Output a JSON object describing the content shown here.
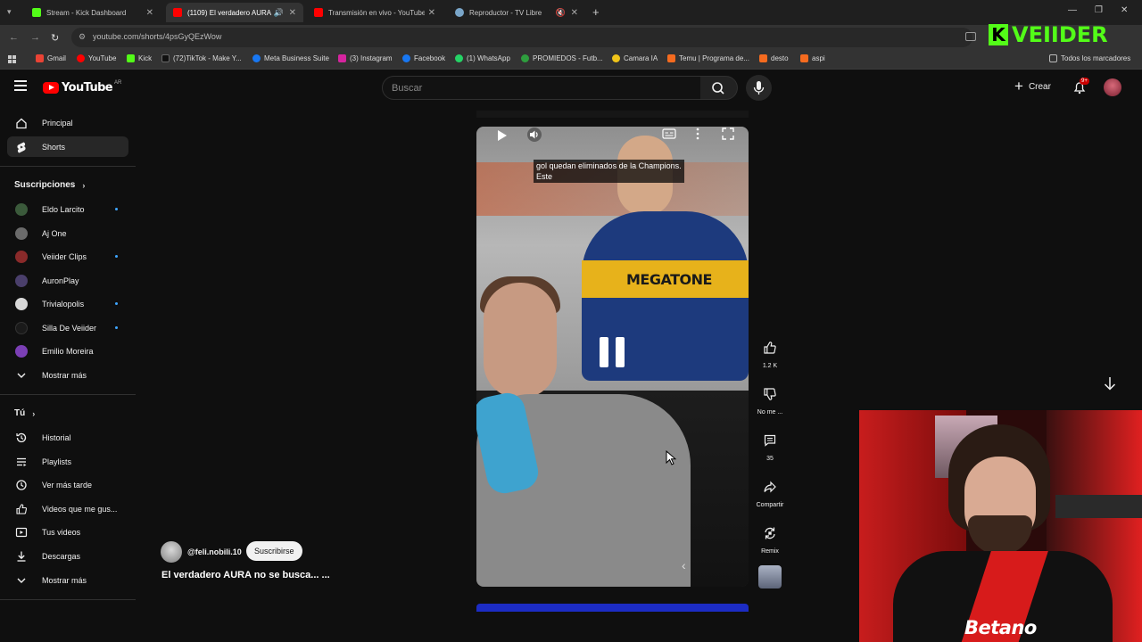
{
  "browser": {
    "tabs": [
      {
        "title": "Stream - Kick Dashboard",
        "icon": "kick-icon",
        "color": "#53fc18"
      },
      {
        "title": "(1109) El verdadero AURA n",
        "icon": "youtube-icon",
        "color": "#ff0000"
      },
      {
        "title": "Transmisión en vivo - YouTube",
        "icon": "youtube-icon",
        "color": "#ff0000"
      },
      {
        "title": "Reproductor - TV Libre",
        "icon": "globe-icon",
        "color": "#7aa6c9"
      }
    ],
    "url": "youtube.com/shorts/4psGyQEzWow",
    "bookmarks": [
      {
        "label": "Gmail",
        "color": "#ea4335"
      },
      {
        "label": "YouTube",
        "color": "#ff0000"
      },
      {
        "label": "Kick",
        "color": "#53fc18"
      },
      {
        "label": "(72)TikTok - Make Y...",
        "color": "#111111"
      },
      {
        "label": "Meta Business Suite",
        "color": "#1877f2"
      },
      {
        "label": "(3) Instagram",
        "color": "#d6249f"
      },
      {
        "label": "Facebook",
        "color": "#1877f2"
      },
      {
        "label": "(1) WhatsApp",
        "color": "#25d366"
      },
      {
        "label": "PROMIEDOS - Futb...",
        "color": "#2e9e3e"
      },
      {
        "label": "Camara IA",
        "color": "#f0c419"
      },
      {
        "label": "Temu | Programa de...",
        "color": "#f56b1f"
      },
      {
        "label": "desto",
        "color": "#f56b1f"
      },
      {
        "label": "aspi",
        "color": "#f56b1f"
      }
    ],
    "all_bookmarks": "Todos los marcadores"
  },
  "overlay": {
    "kick_name": "VEIIDER"
  },
  "youtube": {
    "logo_text": "YouTube",
    "region": "AR",
    "search_placeholder": "Buscar",
    "create_label": "Crear",
    "notification_count": "9+"
  },
  "sidebar": {
    "main": [
      {
        "label": "Principal",
        "icon": "home-icon"
      },
      {
        "label": "Shorts",
        "icon": "shorts-icon"
      }
    ],
    "subscriptions_title": "Suscripciones",
    "subscriptions": [
      {
        "label": "Eldo Larcito",
        "dot": true,
        "color": "#3b5a3b"
      },
      {
        "label": "Aj One",
        "dot": false,
        "color": "#6b6b6b"
      },
      {
        "label": "Veiider Clips",
        "dot": true,
        "color": "#8a2a2a"
      },
      {
        "label": "AuronPlay",
        "dot": false,
        "color": "#4a3f6b"
      },
      {
        "label": "Trivialopolis",
        "dot": true,
        "color": "#d8d8d8"
      },
      {
        "label": "Silla De Veiider",
        "dot": true,
        "color": "#1a1a1a"
      },
      {
        "label": "Emilio Moreira",
        "dot": false,
        "color": "#7b3fb5"
      }
    ],
    "show_more_1": "Mostrar más",
    "you_title": "Tú",
    "you_items": [
      {
        "label": "Historial",
        "icon": "history-icon"
      },
      {
        "label": "Playlists",
        "icon": "playlist-icon"
      },
      {
        "label": "Ver más tarde",
        "icon": "clock-icon"
      },
      {
        "label": "Videos que me gus...",
        "icon": "thumbs-up-icon"
      },
      {
        "label": "Tus videos",
        "icon": "video-icon"
      },
      {
        "label": "Descargas",
        "icon": "download-icon"
      }
    ],
    "show_more_2": "Mostrar más"
  },
  "short": {
    "caption": "gol quedan eliminados de la Champions.\nEste",
    "jersey_text": "MEGATONE",
    "progress": 0.16,
    "likes": "1.2 K",
    "dislike_label": "No me ...",
    "comments": "35",
    "share_label": "Compartir",
    "remix_label": "Remix",
    "channel_handle": "@feli.nobili.10",
    "subscribe_label": "Suscribirse",
    "title": "El verdadero AURA no se busca... ..."
  },
  "webcam": {
    "sponsor": "Betano"
  }
}
